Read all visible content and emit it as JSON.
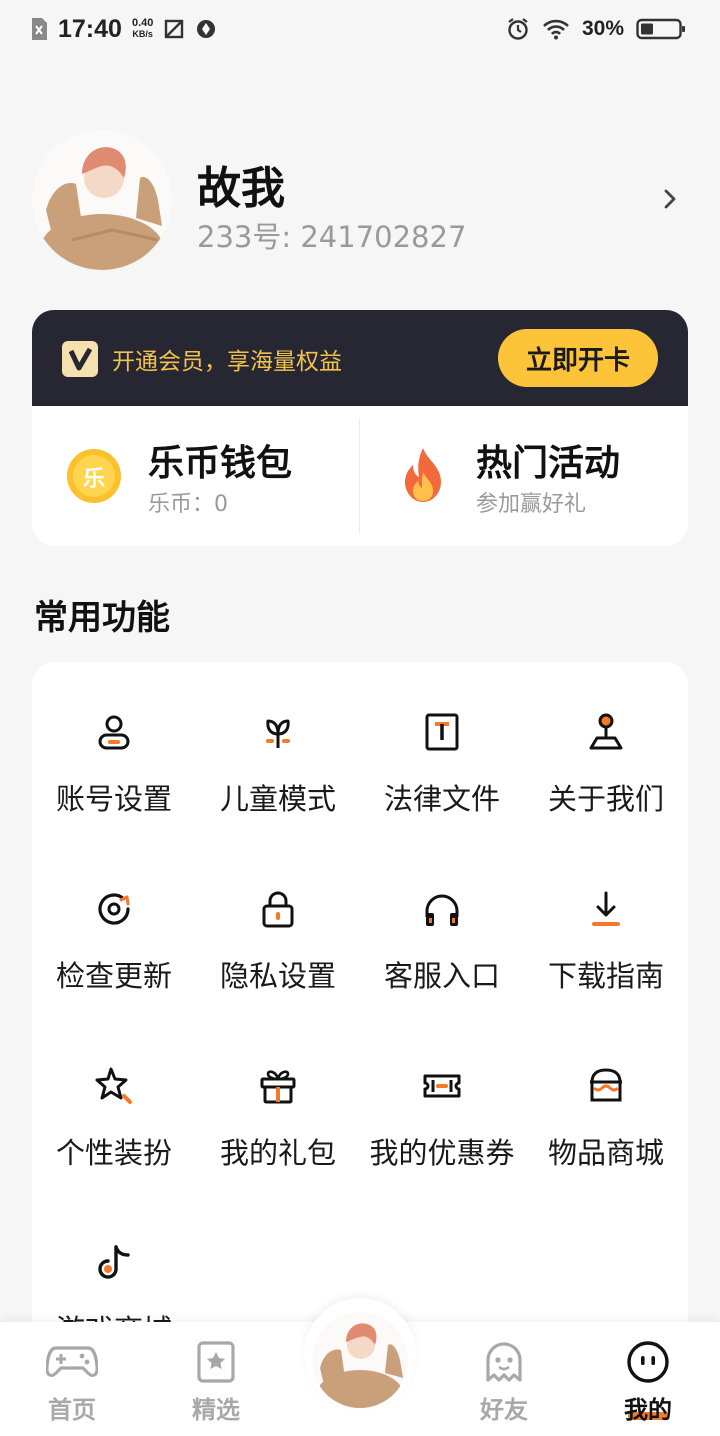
{
  "status_bar": {
    "time": "17:40",
    "net_speed_value": "0.40",
    "net_speed_unit": "KB/s",
    "battery": "30%"
  },
  "profile": {
    "name": "故我",
    "id_text": "233号: 241702827"
  },
  "vip": {
    "text": "开通会员，享海量权益",
    "button": "立即开卡"
  },
  "wallet": {
    "title": "乐币钱包",
    "subtitle": "乐币：0",
    "coin_glyph": "乐"
  },
  "activity": {
    "title": "热门活动",
    "subtitle": "参加赢好礼"
  },
  "section": {
    "title": "常用功能"
  },
  "functions": [
    {
      "label": "账号设置",
      "icon": "user-icon"
    },
    {
      "label": "儿童模式",
      "icon": "sprout-icon"
    },
    {
      "label": "法律文件",
      "icon": "document-icon"
    },
    {
      "label": "关于我们",
      "icon": "joystick-icon"
    },
    {
      "label": "检查更新",
      "icon": "refresh-icon"
    },
    {
      "label": "隐私设置",
      "icon": "lock-icon"
    },
    {
      "label": "客服入口",
      "icon": "headphones-icon"
    },
    {
      "label": "下载指南",
      "icon": "download-icon"
    },
    {
      "label": "个性装扮",
      "icon": "star-icon"
    },
    {
      "label": "我的礼包",
      "icon": "gift-icon"
    },
    {
      "label": "我的优惠券",
      "icon": "ticket-icon"
    },
    {
      "label": "物品商城",
      "icon": "store-icon"
    },
    {
      "label": "游戏商城",
      "icon": "music-note-icon"
    }
  ],
  "nav": {
    "home": "首页",
    "featured": "精选",
    "friends": "好友",
    "mine": "我的"
  },
  "colors": {
    "accent": "#f47a2a",
    "vip_gold": "#fdc43a",
    "banner_dark": "#272733"
  }
}
